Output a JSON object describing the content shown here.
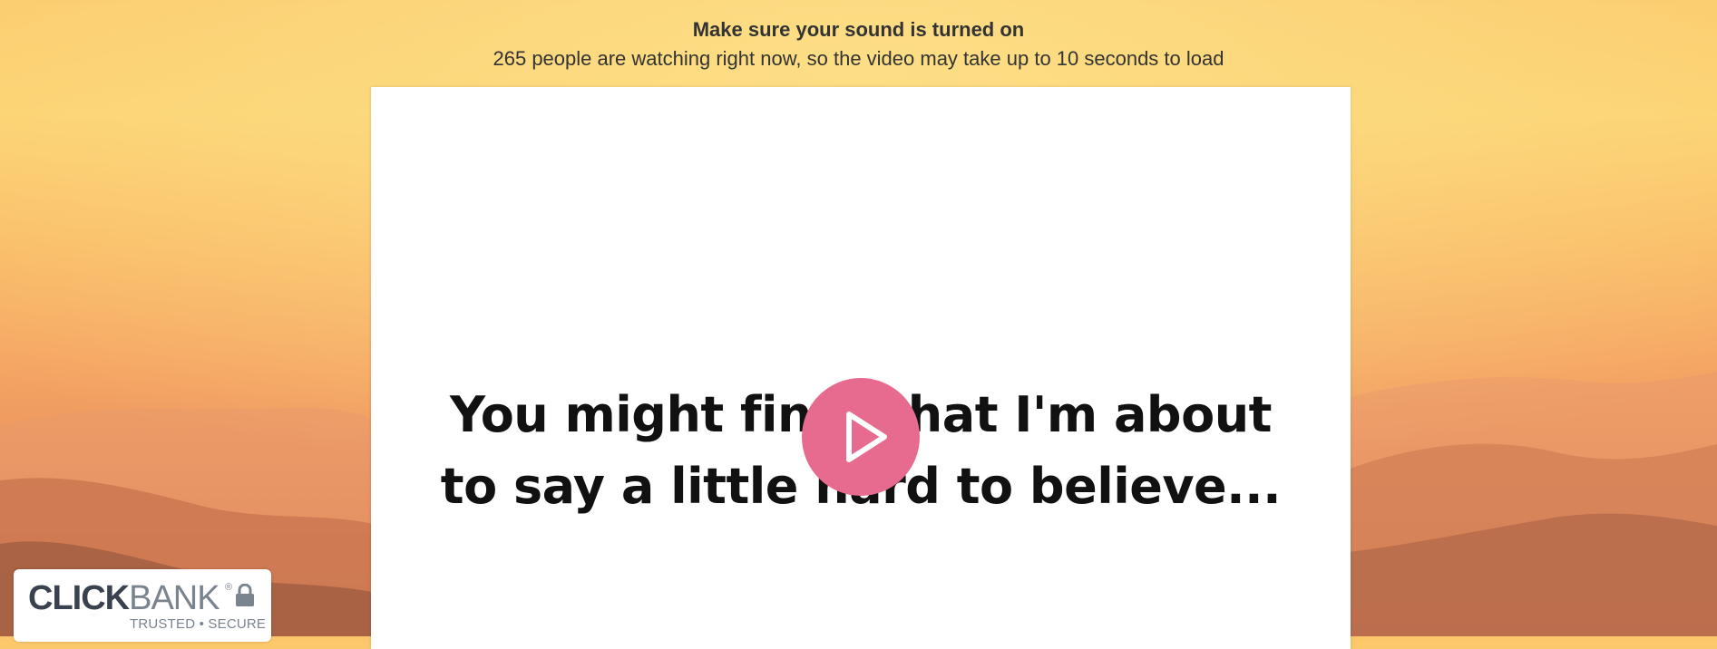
{
  "header": {
    "title": "Make sure your sound is turned on",
    "subtitle": "265 people are watching right now, so the video may take up to 10 seconds to load"
  },
  "video": {
    "caption_line1": "You might find what I'm about",
    "caption_line2": "to say a little hard to believe...",
    "play_icon": "play-icon"
  },
  "badge": {
    "brand_bold": "CLICK",
    "brand_light": "BANK",
    "registered": "®",
    "tagline": "TRUSTED • SECURE",
    "icon": "lock-icon"
  },
  "colors": {
    "play_button": "#e76b8f",
    "text": "#333333",
    "badge_dark": "#39424e",
    "badge_light": "#7a848f"
  }
}
